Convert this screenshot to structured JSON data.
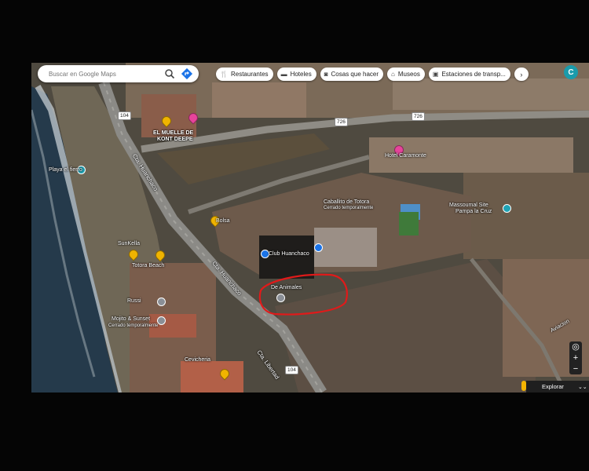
{
  "search": {
    "placeholder": "Buscar en Google Maps"
  },
  "chips": [
    {
      "label": "Restaurantes",
      "icon": "fork-knife-icon"
    },
    {
      "label": "Hoteles",
      "icon": "bed-icon"
    },
    {
      "label": "Cosas que hacer",
      "icon": "camera-icon"
    },
    {
      "label": "Museos",
      "icon": "bank-icon"
    },
    {
      "label": "Estaciones de transp...",
      "icon": "bus-icon"
    }
  ],
  "avatar": {
    "letter": "C",
    "color": "#1a9bab"
  },
  "pois": {
    "playa": "Playa el fierro",
    "sunkella": "SunKella",
    "totora_beach": "Totora Beach",
    "mojito": "Mojito & Sunset",
    "mojito_sub": "Cerrado temporalmente",
    "club": "Club Huanchaco",
    "caballito": "Caballito de Totora",
    "caballito_sub": "Cerrado temporalmente",
    "animales": "De Animales",
    "hotel": "Hotel Caramonte",
    "massoumal": "Massoumal Site",
    "massoumal_sub": "Pampa la Cruz",
    "el_muelle": "EL MUELLE DE",
    "el_muelle_sub": "KONT DEEPE",
    "unreadable_pin": "La parroquia",
    "bolsa": "Bolsa",
    "aviacion": "Aviacion",
    "cevicheria": "Cevicheria",
    "cevicheria_sub": "Cerrado temporalmente",
    "rusia": "Russi"
  },
  "roads": {
    "cta_huanchaco_1": "Cta. Huanchaco",
    "cta_huanchaco_2": "Cta. Huanchaco",
    "la_libertad": "Cta. Libertad",
    "shield_104_top": "104",
    "shield_104_bottom": "104",
    "shield_726_a": "726",
    "shield_726_b": "726"
  },
  "controls": {
    "zoom_in": "+",
    "zoom_out": "−",
    "explore": "Explorar"
  },
  "colors": {
    "sea": "#22384a",
    "foam": "#d9dfe2",
    "sand": "#6d6354",
    "road": "#8b8a86",
    "annotation": "#e01a1a",
    "pin_yellow": "#f0b400",
    "pin_pink": "#e7449b",
    "pin_teal": "#20a3b5"
  }
}
